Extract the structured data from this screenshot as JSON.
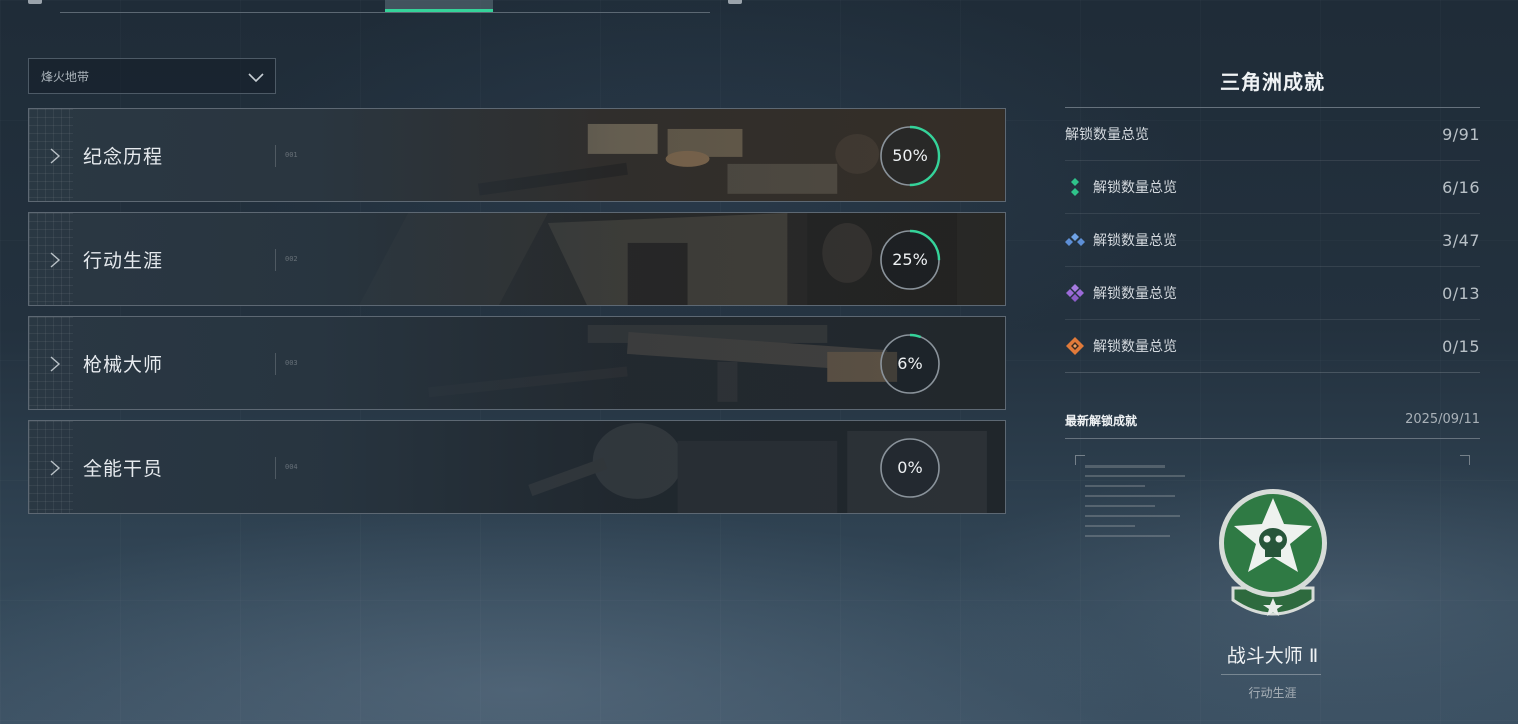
{
  "topbar": {
    "tabs": [
      "",
      "",
      "",
      "",
      "",
      ""
    ],
    "active_index": 3
  },
  "filter": {
    "selected": "烽火地带"
  },
  "categories": [
    {
      "name": "纪念历程",
      "code": "001",
      "progress_pct": 50,
      "progress_label": "50%"
    },
    {
      "name": "行动生涯",
      "code": "002",
      "progress_pct": 25,
      "progress_label": "25%"
    },
    {
      "name": "枪械大师",
      "code": "003",
      "progress_pct": 6,
      "progress_label": "6%"
    },
    {
      "name": "全能干员",
      "code": "004",
      "progress_pct": 0,
      "progress_label": "0%"
    }
  ],
  "panel": {
    "title": "三角洲成就",
    "total": {
      "label": "解锁数量总览",
      "value": "9/91"
    },
    "tiers": [
      {
        "icon": "green-tier-icon",
        "color": "#2fc38a",
        "label": "解锁数量总览",
        "value": "6/16"
      },
      {
        "icon": "blue-tier-icon",
        "color": "#5d8fd6",
        "label": "解锁数量总览",
        "value": "3/47"
      },
      {
        "icon": "purple-tier-icon",
        "color": "#9b6ad8",
        "label": "解锁数量总览",
        "value": "0/13"
      },
      {
        "icon": "orange-tier-icon",
        "color": "#e07a3a",
        "label": "解锁数量总览",
        "value": "0/15"
      }
    ]
  },
  "latest": {
    "label": "最新解锁成就",
    "date": "2025/09/11",
    "achievement_name": "战斗大师 Ⅱ",
    "achievement_category": "行动生涯",
    "badge_icon": "star-skull-badge-icon"
  },
  "colors": {
    "accent": "#35d39a",
    "ring_track": "#8a939b"
  }
}
